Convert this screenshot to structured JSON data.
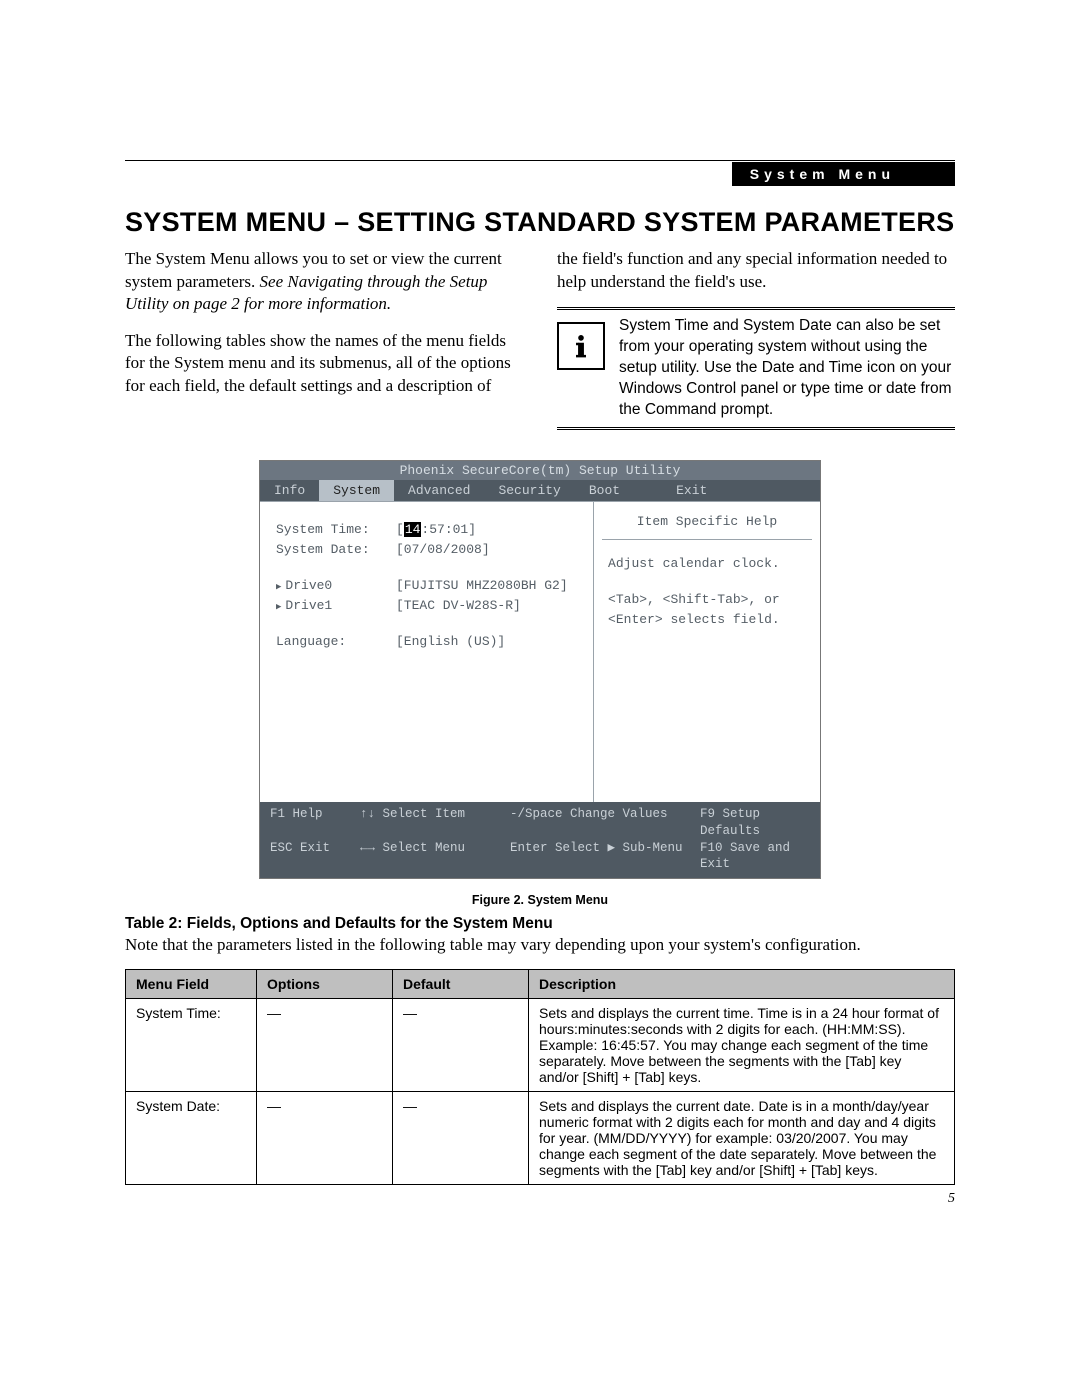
{
  "header": {
    "tag": "System Menu"
  },
  "title": "SYSTEM MENU – SETTING STANDARD SYSTEM PARAMETERS",
  "intro": {
    "p1a": "The System Menu allows you to set or view the current system parameters. ",
    "p1b": "See Navigating through the Setup Utility on page 2 for more information.",
    "p2": "The following tables show the names of the menu fields for the System menu and its submenus, all of the options for each field, the default settings and a description of",
    "p3": "the field's function and any special information needed to help understand the field's use.",
    "note": "System Time and System Date can also be set from your operating system without using the setup utility. Use the Date and Time icon on your Windows Control panel or type time or date from the Command prompt."
  },
  "bios": {
    "window_title": "Phoenix SecureCore(tm) Setup Utility",
    "tabs": [
      "Info",
      "System",
      "Advanced",
      "Security",
      "Boot",
      "Exit"
    ],
    "active_tab": "System",
    "rows": {
      "time_label": "System Time:",
      "time_value_prefix": "[",
      "time_value_hi": "14",
      "time_value_rest": ":57:01]",
      "date_label": "System Date:",
      "date_value": "[07/08/2008]",
      "drive0_label": "Drive0",
      "drive0_value": "[FUJITSU MHZ2080BH G2]",
      "drive1_label": "Drive1",
      "drive1_value": "[TEAC DV-W28S-R]",
      "lang_label": "Language:",
      "lang_value": "[English (US)]"
    },
    "help": {
      "title": "Item Specific Help",
      "l1": "Adjust calendar clock.",
      "l2": "<Tab>, <Shift-Tab>, or",
      "l3": "<Enter> selects field."
    },
    "footer": {
      "r1a": "F1  Help",
      "r1b": "↑↓ Select Item",
      "r1c": "-/Space  Change Values",
      "r1d": "F9   Setup Defaults",
      "r2a": "ESC Exit",
      "r2b": "←→ Select Menu",
      "r2c": "Enter    Select ▶ Sub-Menu",
      "r2d": "F10  Save and Exit"
    }
  },
  "figure_caption": "Figure 2.   System Menu",
  "table_section": {
    "title": "Table 2: Fields, Options and Defaults for the System Menu",
    "note": "Note that the parameters listed in the following table may vary depending upon your system's configuration.",
    "headers": [
      "Menu Field",
      "Options",
      "Default",
      "Description"
    ],
    "rows": [
      {
        "field": "System Time:",
        "options": "—",
        "default_": "—",
        "desc": "Sets and displays the current time. Time is in a 24 hour format of hours:minutes:seconds with 2 digits for each. (HH:MM:SS). Example: 16:45:57. You may change each segment of the time separately. Move between the segments with the [Tab] key and/or [Shift] + [Tab] keys."
      },
      {
        "field": "System Date:",
        "options": "—",
        "default_": "—",
        "desc": "Sets and displays the current date. Date is in a month/day/year numeric format with 2 digits each for month and day and 4 digits for year. (MM/DD/YYYY) for example: 03/20/2007. You may change each segment of the date separately. Move between the segments with the [Tab] key and/or [Shift] + [Tab] keys."
      }
    ]
  },
  "page_number": "5"
}
